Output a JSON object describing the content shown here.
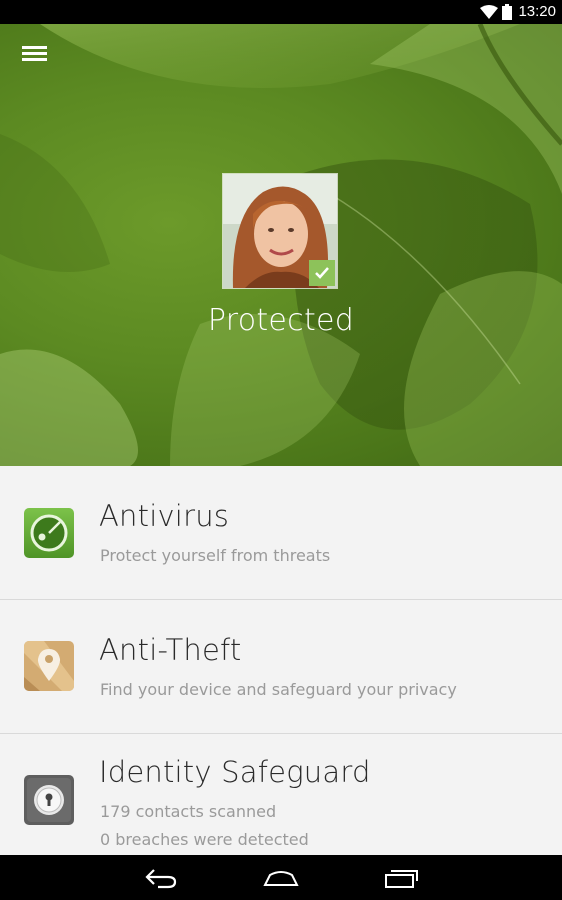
{
  "status_bar": {
    "time": "13:20",
    "icons": [
      "wifi-icon",
      "battery-icon"
    ]
  },
  "hero": {
    "menu_icon": "hamburger-menu-icon",
    "status": "Protected",
    "badge_icon": "checkmark-icon"
  },
  "features": [
    {
      "title": "Antivirus",
      "lines": [
        "Protect yourself from threats"
      ],
      "icon": "antivirus-radar-icon",
      "color": "#6db33f"
    },
    {
      "title": "Anti-Theft",
      "lines": [
        "Find your device and safeguard your privacy"
      ],
      "icon": "map-pin-icon",
      "color": "#c9a26a"
    },
    {
      "title": "Identity Safeguard",
      "lines": [
        "179 contacts scanned",
        "0 breaches were detected"
      ],
      "icon": "padlock-icon",
      "color": "#5c5c5c"
    }
  ],
  "nav_bar": {
    "buttons": [
      "back-icon",
      "home-icon",
      "recent-apps-icon"
    ]
  }
}
